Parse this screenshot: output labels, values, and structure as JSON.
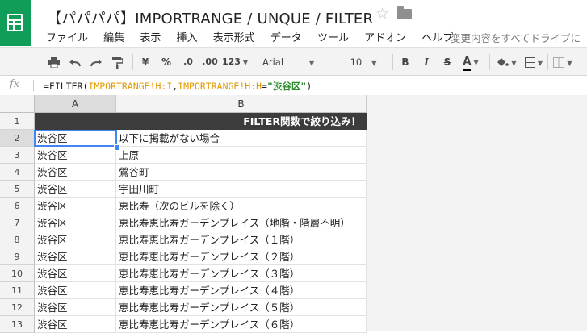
{
  "app": {
    "title": "【パパパパ】IMPORTRANGE / UNQUE / FILTER",
    "save_status": "変更内容をすべてドライブに"
  },
  "menu": [
    "ファイル",
    "編集",
    "表示",
    "挿入",
    "表示形式",
    "データ",
    "ツール",
    "アドオン",
    "ヘルプ"
  ],
  "toolbar": {
    "currency": "¥",
    "percent": "%",
    "decimal_decrease": ".0",
    "decimal_increase": ".00",
    "number_format": "123",
    "font": "Arial",
    "font_size": "10",
    "bold": "B",
    "italic": "I",
    "strike": "S",
    "text_color": "A",
    "text_color_value": "#000000"
  },
  "formula_bar": {
    "fx": "fx",
    "prefix": "=FILTER(",
    "range1": "IMPORTRANGE!H:I",
    "comma": ",",
    "range2": "IMPORTRANGE!H:H",
    "eq": "=",
    "criterion": "\"渋谷区\"",
    "suffix": ")"
  },
  "grid": {
    "columns": [
      "A",
      "B"
    ],
    "header_row": {
      "num": "1",
      "text": "FILTER関数で絞り込み！"
    },
    "rows": [
      {
        "num": "2",
        "a": "渋谷区",
        "b": "以下に掲載がない場合"
      },
      {
        "num": "3",
        "a": "渋谷区",
        "b": "上原"
      },
      {
        "num": "4",
        "a": "渋谷区",
        "b": "鶯谷町"
      },
      {
        "num": "5",
        "a": "渋谷区",
        "b": "宇田川町"
      },
      {
        "num": "6",
        "a": "渋谷区",
        "b": "恵比寿（次のビルを除く）"
      },
      {
        "num": "7",
        "a": "渋谷区",
        "b": "恵比寿恵比寿ガーデンプレイス（地階・階層不明）"
      },
      {
        "num": "8",
        "a": "渋谷区",
        "b": "恵比寿恵比寿ガーデンプレイス（１階）"
      },
      {
        "num": "9",
        "a": "渋谷区",
        "b": "恵比寿恵比寿ガーデンプレイス（２階）"
      },
      {
        "num": "10",
        "a": "渋谷区",
        "b": "恵比寿恵比寿ガーデンプレイス（３階）"
      },
      {
        "num": "11",
        "a": "渋谷区",
        "b": "恵比寿恵比寿ガーデンプレイス（４階）"
      },
      {
        "num": "12",
        "a": "渋谷区",
        "b": "恵比寿恵比寿ガーデンプレイス（５階）"
      },
      {
        "num": "13",
        "a": "渋谷区",
        "b": "恵比寿恵比寿ガーデンプレイス（６階）"
      }
    ]
  },
  "colors": {
    "brand": "#0f9d58",
    "selection": "#4285f4",
    "header_fill": "#3c3c3c",
    "formula_range": "#e09900",
    "formula_string": "#2a8b2a"
  }
}
